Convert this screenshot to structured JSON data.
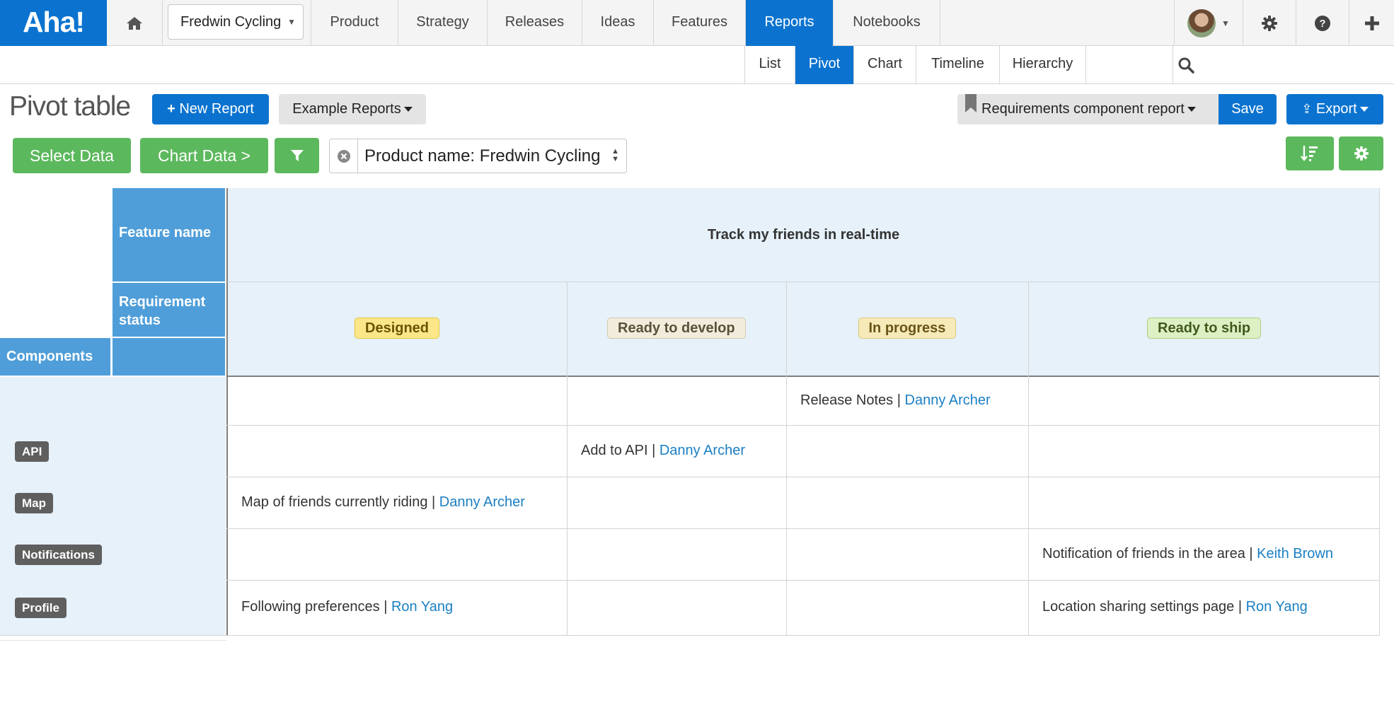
{
  "app": {
    "logo": "Aha!"
  },
  "topnav": {
    "product_select": "Fredwin Cycling",
    "tabs": [
      "Product",
      "Strategy",
      "Releases",
      "Ideas",
      "Features",
      "Reports",
      "Notebooks"
    ],
    "active_tab": "Reports",
    "icons": [
      "home-icon",
      "avatar",
      "gear-icon",
      "help-icon",
      "plus-icon"
    ]
  },
  "subnav": {
    "tabs": [
      "List",
      "Pivot",
      "Chart",
      "Timeline",
      "Hierarchy"
    ],
    "active_tab": "Pivot"
  },
  "toolbar": {
    "title": "Pivot table",
    "new_report": "New Report",
    "example_reports": "Example Reports",
    "saved_report": "Requirements component report",
    "save": "Save",
    "export": "Export",
    "select_data": "Select Data",
    "chart_data": "Chart Data >",
    "filter_label": "Product name: Fredwin Cycling"
  },
  "pivot": {
    "row_header": "Components",
    "col_headers": [
      "Feature name",
      "Requirement status"
    ],
    "feature_name": "Track my friends in real-time",
    "statuses": [
      {
        "label": "Designed",
        "bg": "#fbe78a",
        "border": "#e6c53c",
        "color": "#6b5300"
      },
      {
        "label": "Ready to develop",
        "bg": "#f2ecdc",
        "border": "#d3c9ad",
        "color": "#5a5139"
      },
      {
        "label": "In progress",
        "bg": "#f6eab9",
        "border": "#ddc77a",
        "color": "#6a5416"
      },
      {
        "label": "Ready to ship",
        "bg": "#ddf0c4",
        "border": "#a9cf80",
        "color": "#3f5a1d"
      }
    ],
    "rows": [
      {
        "component": "",
        "cells": [
          "",
          "",
          "Release Notes | ",
          ""
        ],
        "links": [
          "",
          "",
          "Danny Archer",
          ""
        ]
      },
      {
        "component": "API",
        "cells": [
          "",
          "Add to API | ",
          "",
          ""
        ],
        "links": [
          "",
          "Danny Archer",
          "",
          ""
        ]
      },
      {
        "component": "Map",
        "cells": [
          "Map of friends currently riding | ",
          "",
          "",
          ""
        ],
        "links": [
          "Danny Archer",
          "",
          "",
          ""
        ]
      },
      {
        "component": "Notifications",
        "cells": [
          "",
          "",
          "",
          "Notification of friends in the area | "
        ],
        "links": [
          "",
          "",
          "",
          "Keith Brown"
        ]
      },
      {
        "component": "Profile",
        "cells": [
          "Following preferences | ",
          "",
          "",
          "Location sharing settings page | "
        ],
        "links": [
          "Ron Yang",
          "",
          "",
          "Ron Yang"
        ]
      }
    ]
  }
}
